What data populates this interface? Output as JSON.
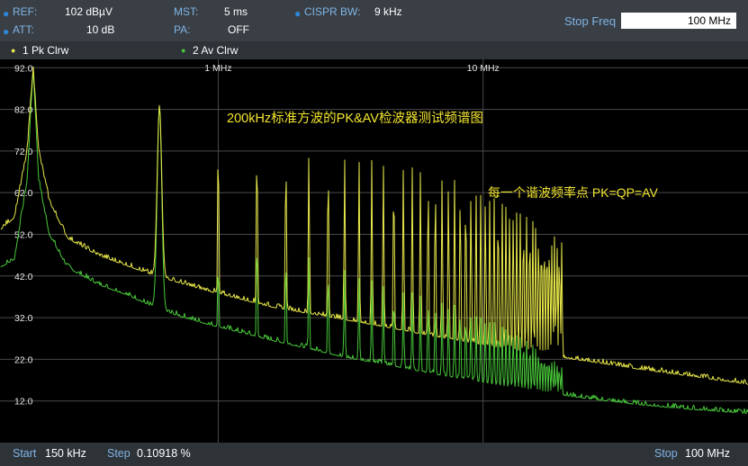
{
  "header": {
    "ref_label": "REF:",
    "ref_value": "102 dBµV",
    "att_label": "ATT:",
    "att_value": "10 dB",
    "mst_label": "MST:",
    "mst_value": "5 ms",
    "pa_label": "PA:",
    "pa_value": "OFF",
    "cispr_label": "CISPR BW:",
    "cispr_value": "9 kHz",
    "stop_freq_label": "Stop Freq",
    "stop_freq_value": "100 MHz"
  },
  "traces_bar": {
    "trace1": "1 Pk  Clrw",
    "trace1_color": "#e8e84a",
    "trace2": "2 Av  Clrw",
    "trace2_color": "#49c93a"
  },
  "footer": {
    "start_label": "Start",
    "start_value": "150 kHz",
    "step_label": "Step",
    "step_value": "0.10918 %",
    "stop_label": "Stop",
    "stop_value": "100 MHz"
  },
  "chart_data": {
    "type": "line",
    "title": "200kHz标准方波的PK&AV检波器测试频谱图",
    "annotation": "每一个谐波频率点 PK=QP=AV",
    "x_scale": "log",
    "xlim_hz": [
      150000,
      100000000
    ],
    "x_ticks": [
      {
        "hz": 1000000,
        "label": "1 MHz"
      },
      {
        "hz": 10000000,
        "label": "10 MHz"
      }
    ],
    "ylim": [
      2,
      94
    ],
    "y_ticks": [
      92.0,
      82.0,
      72.0,
      62.0,
      52.0,
      42.0,
      32.0,
      22.0,
      12.0
    ],
    "grid": true,
    "harmonics_hz": [
      200000,
      600000,
      1000000,
      1400000,
      1800000,
      2200000,
      2600000,
      3000000,
      3400000,
      3800000,
      4200000,
      4600000,
      5000000,
      5400000,
      5800000,
      6200000,
      6600000,
      7000000,
      7400000,
      7800000,
      8200000,
      8600000,
      9000000,
      9400000,
      9800000,
      10200000,
      10600000,
      11000000,
      11400000,
      11800000,
      12200000,
      12600000,
      13000000,
      13400000,
      13800000,
      14200000,
      14600000,
      15000000,
      15400000,
      15800000,
      16200000,
      16600000,
      17000000,
      17400000,
      17800000,
      18200000,
      18600000,
      19000000,
      19400000,
      19800000
    ],
    "series": [
      {
        "name": "1 Pk Clrw",
        "color": "#e8e84a",
        "x_hz": [
          150000,
          170000,
          190000,
          200000,
          210000,
          230000,
          270000,
          350000,
          450000,
          550000,
          700000,
          900000,
          1200000,
          1600000,
          2200000,
          3000000,
          4500000,
          6500000,
          10000000,
          15000000,
          25000000,
          40000000,
          60000000,
          100000000
        ],
        "y": [
          53,
          56,
          72,
          92,
          72,
          60,
          51,
          47,
          44.5,
          42.5,
          40.5,
          38.5,
          36.5,
          34.5,
          33,
          31.5,
          29.5,
          27.5,
          25.5,
          23.5,
          21.5,
          19.5,
          18,
          16
        ],
        "peaks": [
          92,
          83,
          78,
          77,
          74,
          73,
          72,
          71,
          70.5,
          70,
          69.5,
          69,
          68.5,
          68,
          67.5,
          67,
          66.5,
          66,
          65.5,
          65,
          64.5,
          64,
          63.5,
          63,
          62.5,
          62,
          61.5,
          61,
          60.5,
          60,
          59.5,
          59,
          58.5,
          58,
          57.5,
          57,
          56.5,
          56,
          55.5,
          55,
          54.5,
          54,
          53.5,
          53,
          52.5,
          52,
          51.5,
          51,
          50.5,
          50
        ]
      },
      {
        "name": "2 Av Clrw",
        "color": "#49c93a",
        "x_hz": [
          150000,
          170000,
          190000,
          200000,
          210000,
          230000,
          270000,
          350000,
          450000,
          550000,
          700000,
          900000,
          1200000,
          1600000,
          2200000,
          3000000,
          4500000,
          6500000,
          10000000,
          15000000,
          25000000,
          40000000,
          60000000,
          100000000
        ],
        "y": [
          44,
          46,
          65,
          92,
          65,
          52,
          44,
          40,
          37.5,
          35,
          32.5,
          30.5,
          28.5,
          26.5,
          24.5,
          22.5,
          20.5,
          18.5,
          16.5,
          14.5,
          12.5,
          11,
          10,
          9
        ],
        "peaks": [
          92,
          83,
          46,
          53,
          48,
          48,
          45,
          44,
          42,
          41,
          40,
          39,
          38.5,
          38,
          37.5,
          37,
          36.5,
          36,
          35.5,
          35,
          34.5,
          34,
          33.5,
          33,
          32.5,
          32,
          31.5,
          31,
          30.5,
          30,
          29.5,
          29,
          28.5,
          28,
          27.5,
          27,
          26.5,
          26,
          25.5,
          25,
          24.5,
          24,
          23.5,
          23,
          22.5,
          22,
          21.5,
          21,
          20.5,
          20
        ]
      }
    ]
  }
}
